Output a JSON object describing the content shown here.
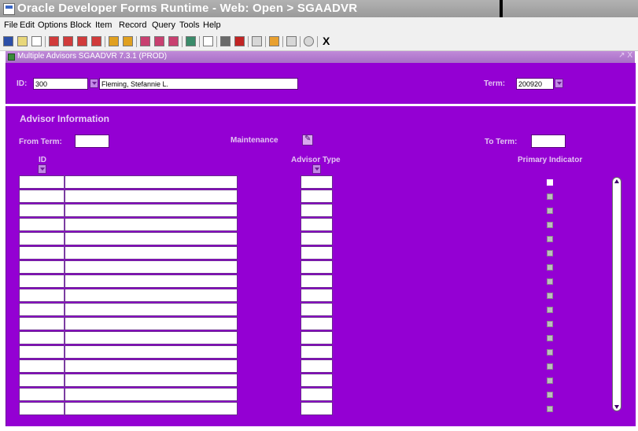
{
  "window": {
    "title": "Oracle Developer Forms Runtime - Web:  Open > SGAADVR"
  },
  "menu": [
    "File",
    "Edit",
    "Options",
    "Block",
    "Item",
    "Record",
    "Query",
    "Tools",
    "Help"
  ],
  "toolbar": {
    "icons": [
      "save-icon",
      "rollback-icon",
      "print-icon",
      "previous-block-icon",
      "previous-record-icon",
      "next-record-icon",
      "next-block-icon",
      "insert-record-icon",
      "remove-record-icon",
      "enter-query-icon",
      "execute-query-icon",
      "cancel-query-icon",
      "find-icon",
      "print-screen-icon",
      "export-icon",
      "clear-icon",
      "help-icon",
      "list-icon",
      "options-icon",
      "exit-icon"
    ],
    "exit_label": "X"
  },
  "form": {
    "title": "Multiple Advisors  SGAADVR  7.3.1  (PROD)",
    "window_controls": "↗ X",
    "key_block": {
      "id_label": "ID:",
      "id_value": "300",
      "name_value": "Fleming, Stefannie L.",
      "term_label": "Term:",
      "term_value": "200920"
    },
    "advisor_section": {
      "title": "Advisor Information",
      "from_term_label": "From Term:",
      "from_term_value": "",
      "maintenance_label": "Maintenance",
      "to_term_label": "To Term:",
      "to_term_value": "",
      "col_id": "ID",
      "col_advisor_type": "Advisor Type",
      "col_primary": "Primary Indicator",
      "row_count": 17
    }
  },
  "colors": {
    "form_background": "#9400d3",
    "label_text": "#e3c4f2",
    "titlebar": "#a8a8a8"
  }
}
